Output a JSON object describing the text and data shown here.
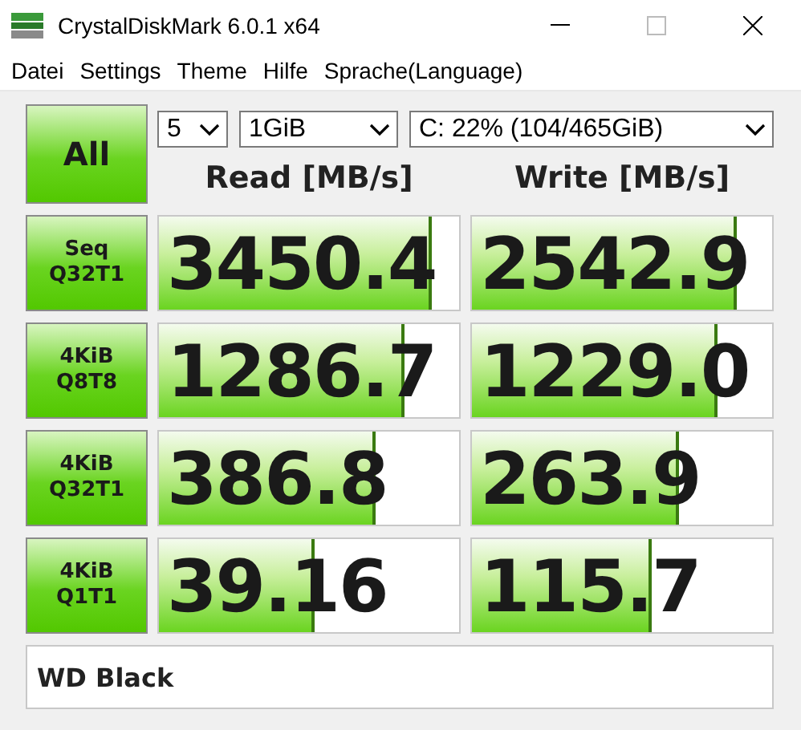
{
  "window": {
    "title": "CrystalDiskMark 6.0.1 x64"
  },
  "menu": [
    "Datei",
    "Settings",
    "Theme",
    "Hilfe",
    "Sprache(Language)"
  ],
  "all_button": "All",
  "count_select": {
    "value": "5"
  },
  "size_select": {
    "value": "1GiB"
  },
  "drive_select": {
    "value": "C: 22% (104/465GiB)"
  },
  "headers": {
    "read": "Read [MB/s]",
    "write": "Write [MB/s]"
  },
  "tests": [
    {
      "label": [
        "Seq",
        "Q32T1"
      ],
      "read": {
        "value": "3450.4",
        "level": 0.9
      },
      "write": {
        "value": "2542.9",
        "level": 0.87
      }
    },
    {
      "label": [
        "4KiB",
        "Q8T8"
      ],
      "read": {
        "value": "1286.7",
        "level": 0.81
      },
      "write": {
        "value": "1229.0",
        "level": 0.81
      }
    },
    {
      "label": [
        "4KiB",
        "Q32T1"
      ],
      "read": {
        "value": "386.8",
        "level": 0.71
      },
      "write": {
        "value": "263.9",
        "level": 0.68
      }
    },
    {
      "label": [
        "4KiB",
        "Q1T1"
      ],
      "read": {
        "value": "39.16",
        "level": 0.51
      },
      "write": {
        "value": "115.7",
        "level": 0.59
      }
    }
  ],
  "comment": {
    "value": "WD Black"
  }
}
